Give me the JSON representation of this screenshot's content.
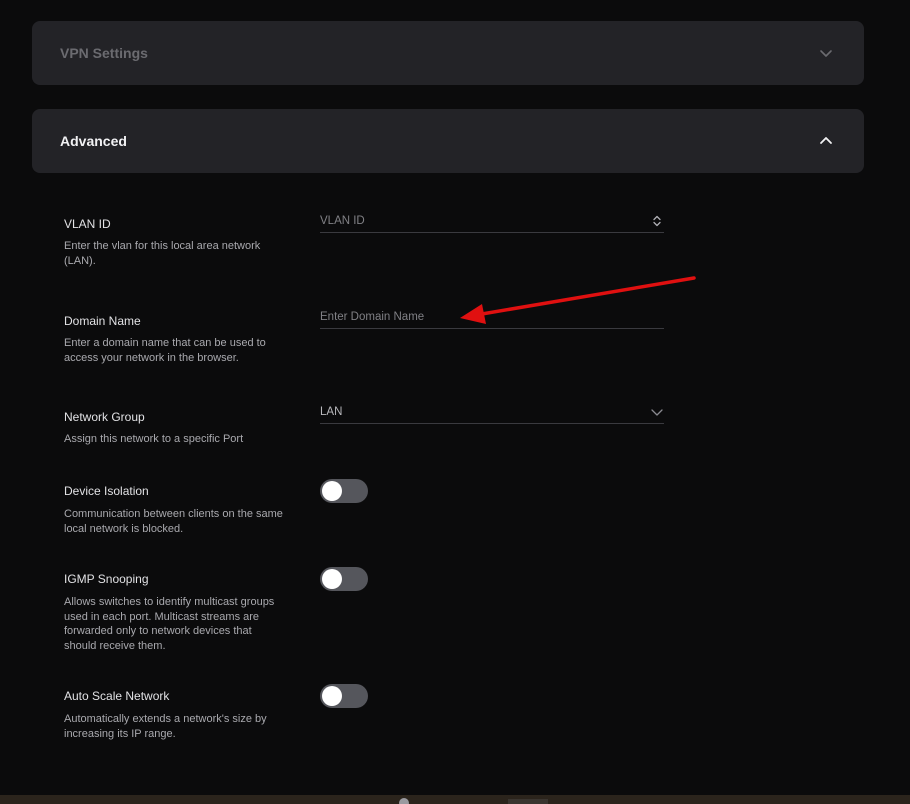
{
  "sections": {
    "vpn": {
      "title": "VPN Settings",
      "expanded": false
    },
    "advanced": {
      "title": "Advanced",
      "expanded": true
    }
  },
  "fields": {
    "vlan_id": {
      "label": "VLAN ID",
      "description": "Enter the vlan for this local area network (LAN).",
      "placeholder": "VLAN ID",
      "control": "number-stepper"
    },
    "domain_name": {
      "label": "Domain Name",
      "description": "Enter a domain name that can be used to access your network in the browser.",
      "placeholder": "Enter Domain Name",
      "control": "text-input"
    },
    "network_group": {
      "label": "Network Group",
      "description": "Assign this network to a specific Port",
      "value": "LAN",
      "control": "select"
    },
    "device_isolation": {
      "label": "Device Isolation",
      "description": "Communication between clients on the same local network is blocked.",
      "enabled": false
    },
    "igmp_snooping": {
      "label": "IGMP Snooping",
      "description": "Allows switches to identify multicast groups used in each port. Multicast streams are forwarded only to network devices that should receive them.",
      "enabled": false
    },
    "auto_scale_network": {
      "label": "Auto Scale Network",
      "description": "Automatically extends a network's size by increasing its IP range.",
      "enabled": false
    }
  },
  "annotation": {
    "type": "arrow",
    "color": "#e01010",
    "target": "domain_name"
  },
  "colors": {
    "background": "#0b0b0c",
    "panel": "#232327",
    "toggle_off": "#55565c",
    "text_primary": "#e2e2e5",
    "text_secondary": "#a9a9ae"
  },
  "icons": {
    "collapsed": "chevron-down-icon",
    "expanded": "chevron-up-icon",
    "stepper": "stepper-icon",
    "select": "chevron-down-icon"
  }
}
